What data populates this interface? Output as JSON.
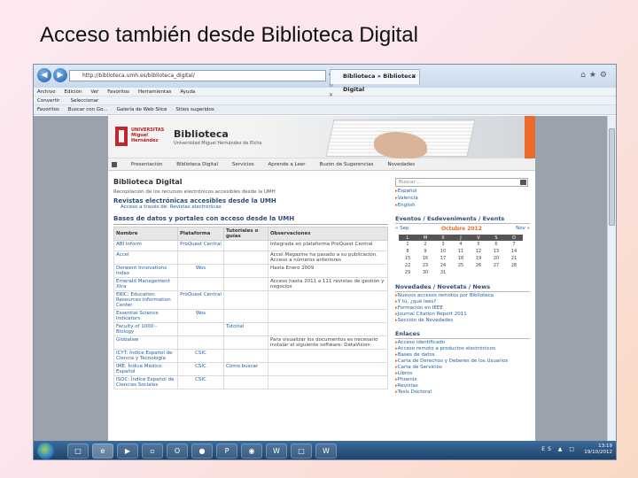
{
  "slide": {
    "title": "Acceso también desde Biblioteca Digital"
  },
  "browser": {
    "address": "http://biblioteca.umh.es/biblioteca_digital/",
    "tab_title": "Biblioteca » Biblioteca Digital",
    "menu": [
      "Archivo",
      "Edición",
      "Ver",
      "Favoritos",
      "Herramientas",
      "Ayuda"
    ],
    "commands": [
      "Convertir",
      "Seleccionar"
    ],
    "favorites": [
      "Favoritos",
      "Buscar con Go...",
      "Galería de Web Slice",
      "Sitios sugeridos"
    ]
  },
  "site": {
    "brand_top": "UNIVERSITAS",
    "brand_mid": "Miguel",
    "brand_bot": "Hernández",
    "name": "Biblioteca",
    "subtitle": "Universidad Miguel Hernández de Elche",
    "nav": [
      "Presentación",
      "Biblioteca Digital",
      "Servicios",
      "Aprende a Leer",
      "Buzón de Sugerencias",
      "Novedades"
    ]
  },
  "content": {
    "heading": "Biblioteca Digital",
    "intro": "Recopilación de los recursos electrónicos accesibles desde la UMH",
    "journals_title": "Revistas electrónicas accesibles desde la UMH",
    "journals_link": "Acceso a través de: Revistas electrónicas",
    "db_title": "Bases de datos y portales con acceso desde la UMH",
    "columns": [
      "Nombre",
      "Plataforma",
      "Tutoriales o guías",
      "Observaciones"
    ],
    "rows": [
      [
        "ABI Inform",
        "ProQuest Central",
        "",
        "Integrada en plataforma ProQuest Central"
      ],
      [
        "Accel",
        "",
        "",
        "Accel Magazine ha pasado a su publicación. Acceso a números anteriores"
      ],
      [
        "Derwent Innovations Index",
        "Wos",
        "",
        "Hasta Enero 2009"
      ],
      [
        "Emerald Management Xtra",
        "",
        "",
        "Acceso hasta 2011 a 111 revistas de gestión y negocios"
      ],
      [
        "ERIC: Education Resources Information Center",
        "ProQuest Central",
        "",
        ""
      ],
      [
        "Essential Science Indicators",
        "Wos",
        "",
        ""
      ],
      [
        "Faculty of 1000 - Biology",
        "",
        "Tutorial",
        ""
      ],
      [
        "Globalaw",
        "",
        "",
        "Para visualizar los documentos es necesario instalar el siguiente software: DataVision"
      ],
      [
        "ICYT: Índice Español de Ciencia y Tecnología",
        "CSIC",
        "",
        ""
      ],
      [
        "IME: Índice Médico Español",
        "CSIC",
        "Cómo buscar",
        ""
      ],
      [
        "ISOC: Índice Español de Ciencias Sociales",
        "CSIC",
        "",
        ""
      ]
    ]
  },
  "sidebar": {
    "search_placeholder": "Buscar ...",
    "languages": [
      "Español",
      "Valencià",
      "English"
    ],
    "events_title": "Eventos / Esdeveniments / Events",
    "prev": "« Sep",
    "month": "Octubre 2012",
    "next": "Nov »",
    "weekdays": [
      "L",
      "M",
      "X",
      "J",
      "V",
      "S",
      "D"
    ],
    "weeks": [
      [
        "1",
        "2",
        "3",
        "4",
        "5",
        "6",
        "7"
      ],
      [
        "8",
        "9",
        "10",
        "11",
        "12",
        "13",
        "14"
      ],
      [
        "15",
        "16",
        "17",
        "18",
        "19",
        "20",
        "21"
      ],
      [
        "22",
        "23",
        "24",
        "25",
        "26",
        "27",
        "28"
      ],
      [
        "29",
        "30",
        "31",
        "",
        "",
        "",
        ""
      ]
    ],
    "news_title": "Novedades / Novetats / News",
    "news": [
      "Nuevos accesos remotos por Biblioteca",
      "Y tú, ¿qué lees?",
      "Formación en IEEE",
      "Journal Citation Report 2011",
      "Sección de Novedades"
    ],
    "links_title": "Enlaces",
    "links": [
      "Acceso identificado",
      "Acceso remoto a productos electrónicos",
      "Bases de datos",
      "Carta de Derechos y Deberes de los Usuarios",
      "Carta de Servicios",
      "Libros",
      "Phoenix",
      "Revistas",
      "Tesis Doctoral"
    ]
  },
  "taskbar": {
    "time": "13:19",
    "date": "19/10/2012",
    "lang": "ES"
  }
}
